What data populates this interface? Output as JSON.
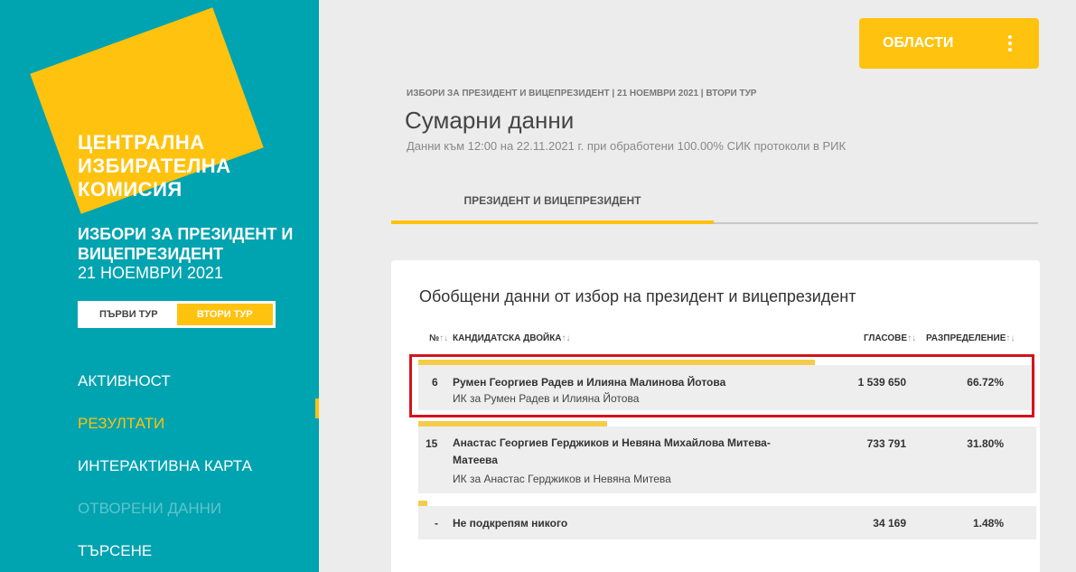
{
  "sidebar": {
    "logo_lines": [
      "ЦЕНТРАЛНА",
      "ИЗБИРАТЕЛНА",
      "КОМИСИЯ"
    ],
    "election_title": "ИЗБОРИ ЗА ПРЕЗИДЕНТ И ВИЦЕПРЕЗИДЕНТ",
    "election_date": "21 НОЕМВРИ 2021",
    "rounds": [
      "ПЪРВИ ТУР",
      "ВТОРИ ТУР"
    ],
    "nav": [
      "АКТИВНОСТ",
      "РЕЗУЛТАТИ",
      "ИНТЕРАКТИВНА КАРТА",
      "ОТВОРЕНИ ДАННИ",
      "ТЪРСЕНЕ"
    ]
  },
  "header": {
    "regions_button": "ОБЛАСТИ",
    "breadcrumb": "ИЗБОРИ ЗА ПРЕЗИДЕНТ И ВИЦЕПРЕЗИДЕНТ | 21 НОЕМВРИ 2021 | ВТОРИ ТУР",
    "title": "Сумарни данни",
    "subtitle": "Данни към 12:00 на 22.11.2021 г. при обработени 100.00% СИК протоколи в РИК",
    "tab": "ПРЕЗИДЕНТ И ВИЦЕПРЕЗИДЕНТ"
  },
  "results": {
    "title": "Обобщени данни от избор на президент и вицепрезидент",
    "columns": {
      "num": "№",
      "candidates": "КАНДИДАТСКА ДВОЙКА",
      "votes": "ГЛАСОВЕ",
      "distribution": "РАЗПРЕДЕЛЕНИЕ"
    },
    "sort_glyph": "↑↓",
    "rows": [
      {
        "num": "6",
        "name": "Румен Георгиев Радев и Илияна Малинова Йотова",
        "committee": "ИК за Румен Радев и Илияна Йотова",
        "votes": "1 539 650",
        "pct": "66.72%",
        "share": 0.6672
      },
      {
        "num": "15",
        "name": "Анастас Георгиев Герджиков и Невяна Михайлова Митева-Матеева",
        "committee": "ИК за Анастас Герджиков и Невяна Митева",
        "votes": "733 791",
        "pct": "31.80%",
        "share": 0.318
      },
      {
        "num": "-",
        "name": "Не подкрепям никого",
        "committee": "",
        "votes": "34 169",
        "pct": "1.48%",
        "share": 0.0148
      }
    ]
  },
  "colors": {
    "teal": "#00a3b0",
    "yellow": "#ffc20e",
    "highlight": "#d4141b"
  }
}
